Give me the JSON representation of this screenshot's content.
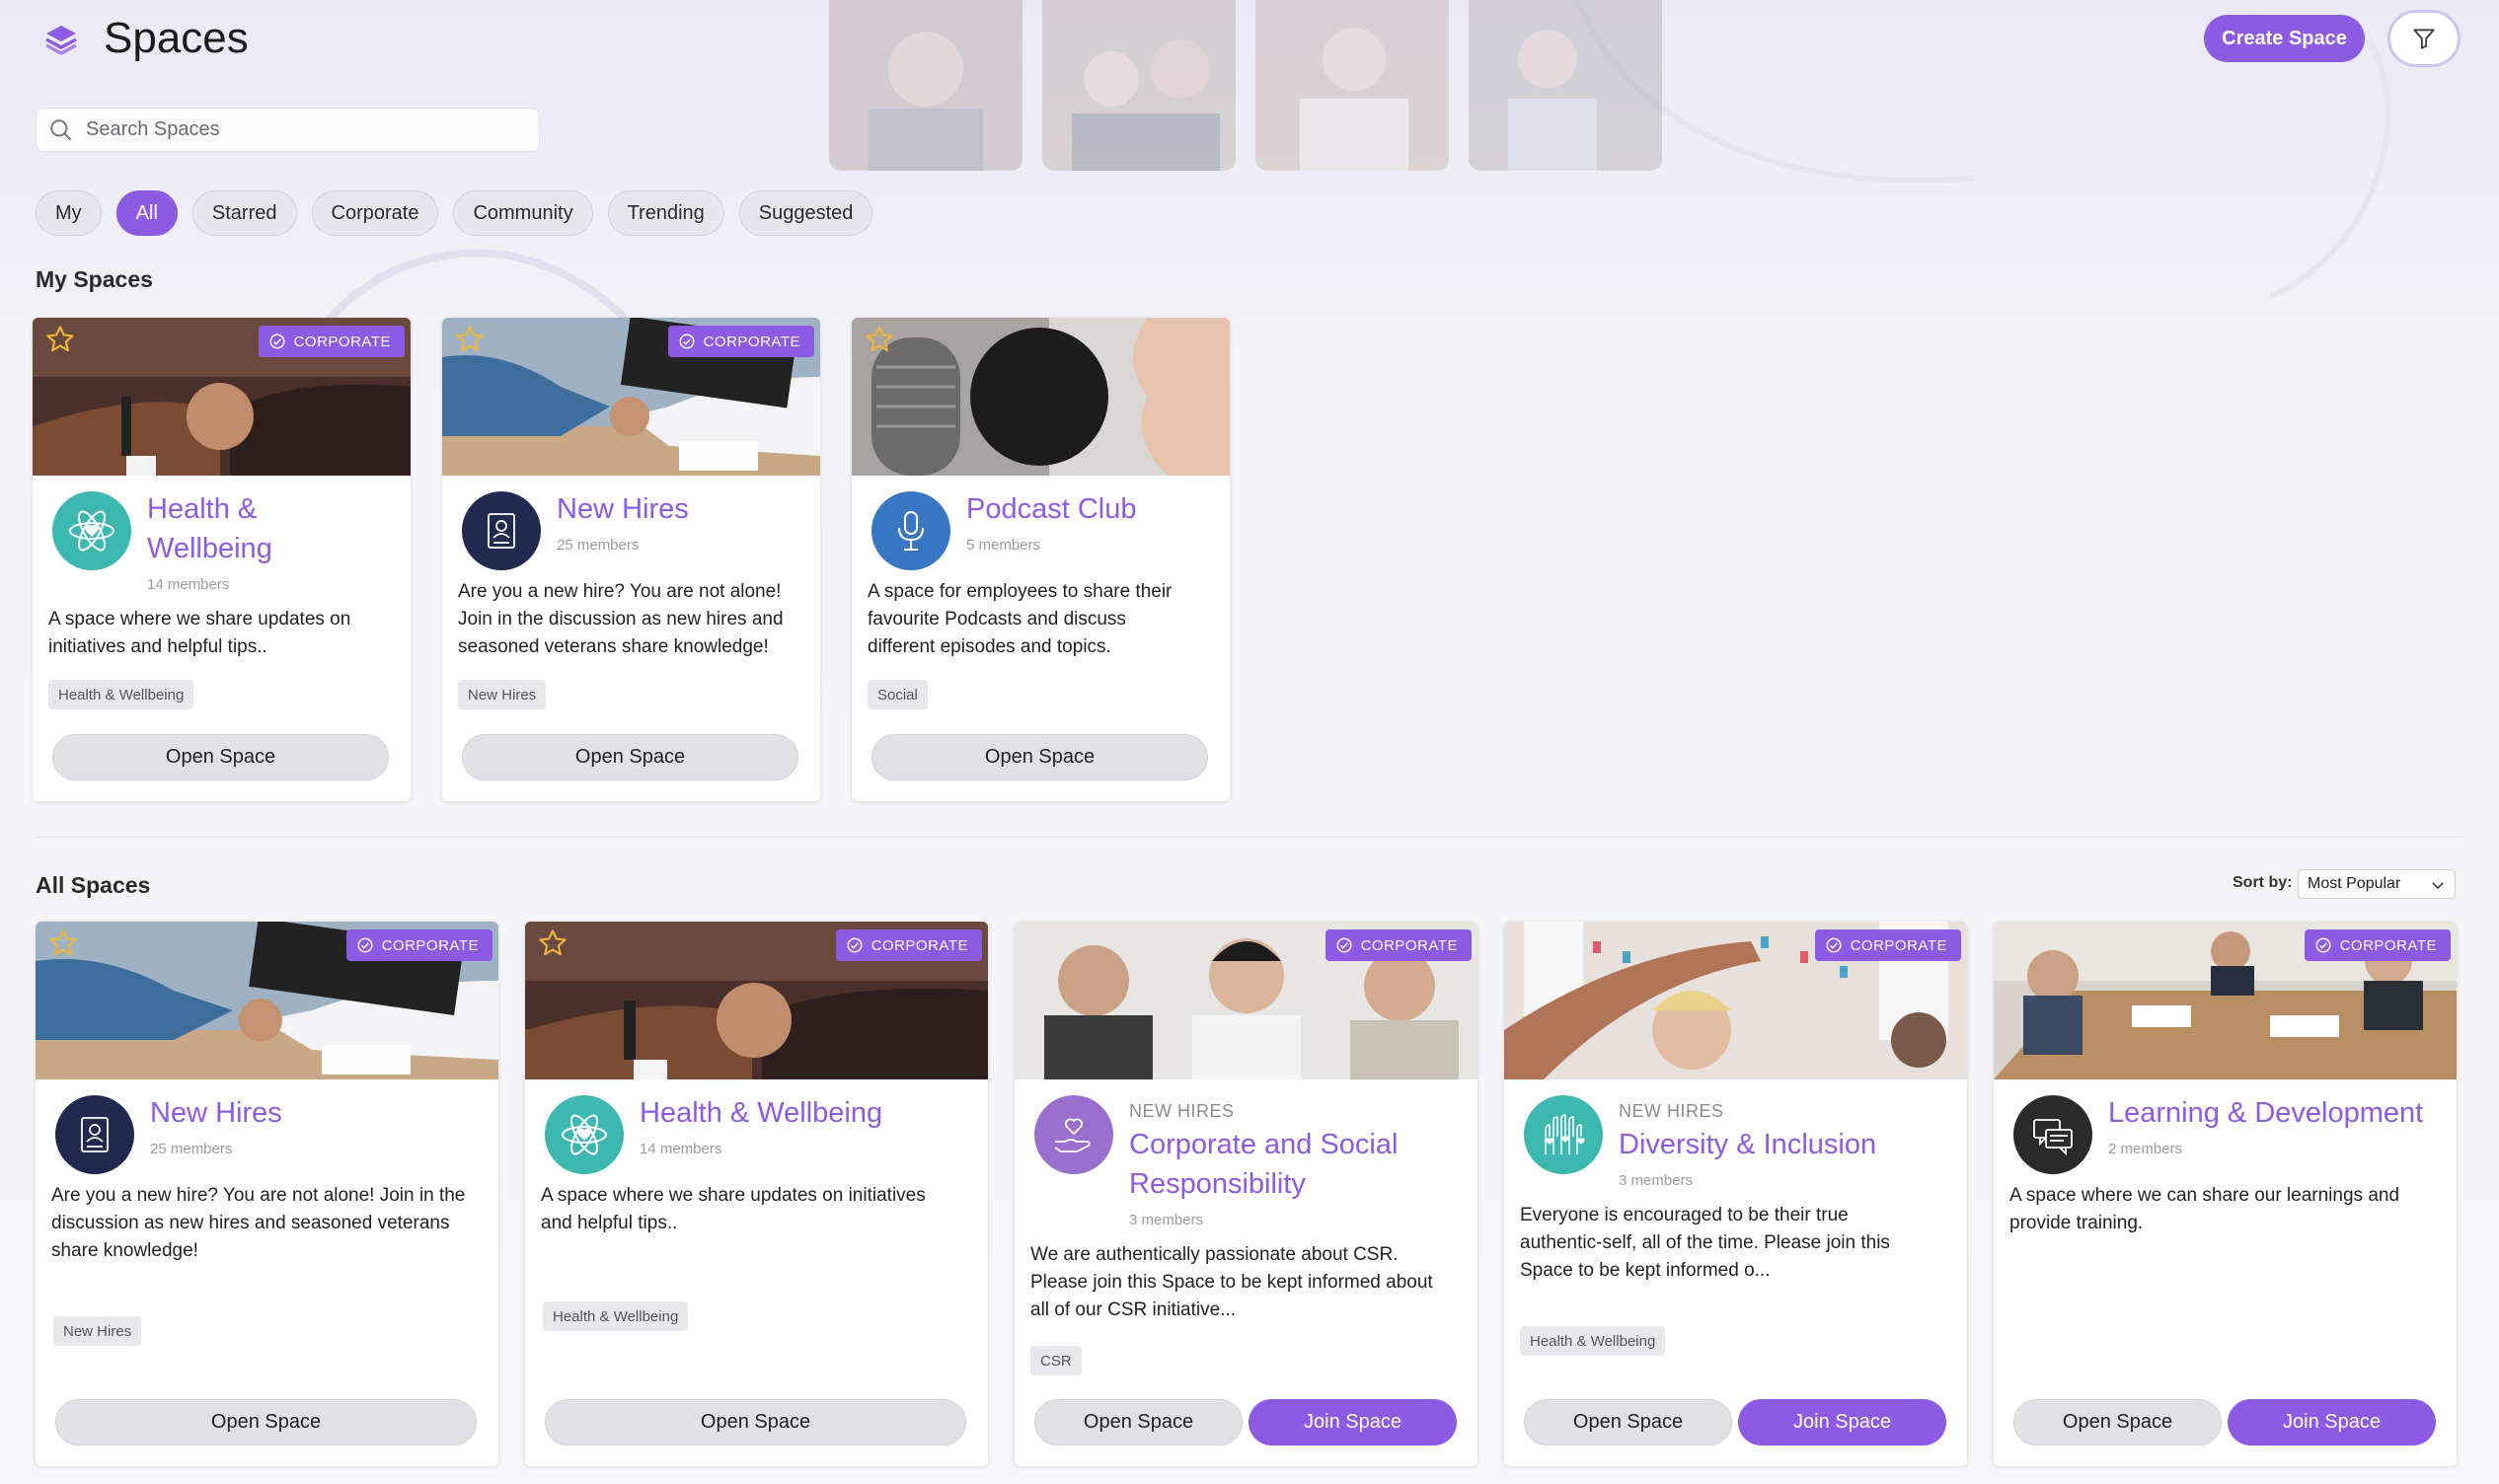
{
  "header": {
    "title": "Spaces",
    "create_label": "Create Space",
    "search_placeholder": "Search Spaces"
  },
  "filters": [
    "My",
    "All",
    "Starred",
    "Corporate",
    "Community",
    "Trending",
    "Suggested"
  ],
  "active_filter": "All",
  "my_spaces": {
    "title": "My Spaces",
    "cards": [
      {
        "title_lines": [
          "Health &",
          "Wellbeing"
        ],
        "members": "14 members",
        "desc": [
          "A space where we share updates on",
          "initiatives and helpful tips.."
        ],
        "tag": "Health & Wellbeing",
        "badge": "CORPORATE",
        "open_label": "Open Space",
        "avatar_icon": "atom-heart-icon",
        "image": "fist-bump-photo"
      },
      {
        "title_lines": [
          "New Hires"
        ],
        "members": "25 members",
        "desc": [
          "Are you a new hire? You are not alone!",
          "Join in the discussion as new hires and",
          "seasoned veterans share knowledge!"
        ],
        "tag": "New Hires",
        "badge": "CORPORATE",
        "open_label": "Open Space",
        "avatar_icon": "id-document-icon",
        "image": "handshake-photo"
      },
      {
        "title_lines": [
          "Podcast Club"
        ],
        "members": "5 members",
        "desc": [
          "A space for employees to share their",
          "favourite Podcasts and discuss",
          "different episodes and topics."
        ],
        "tag": "Social",
        "open_label": "Open Space",
        "avatar_icon": "microphone-icon",
        "image": "microphone-photo"
      }
    ]
  },
  "all_spaces": {
    "title": "All Spaces",
    "sort_label": "Sort by:",
    "sort_value": "Most Popular",
    "cards": [
      {
        "title_lines": [
          "New Hires"
        ],
        "members": "25 members",
        "desc": [
          "Are you a new hire? You are not alone! Join in the",
          "discussion as new hires and seasoned veterans",
          "share knowledge!"
        ],
        "tag": "New Hires",
        "badge": "CORPORATE",
        "open_label": "Open Space",
        "avatar_icon": "id-document-icon"
      },
      {
        "title_lines": [
          "Health & Wellbeing"
        ],
        "members": "14 members",
        "desc": [
          "A space where we share updates on initiatives",
          "and helpful tips.."
        ],
        "tag": "Health & Wellbeing",
        "badge": "CORPORATE",
        "open_label": "Open Space",
        "avatar_icon": "atom-heart-icon"
      },
      {
        "eyebrow": "NEW HIRES",
        "title_lines": [
          "Corporate and Social",
          "Responsibility"
        ],
        "members": "3 members",
        "desc": [
          "We are authentically passionate about CSR.",
          "Please join this Space to be kept informed about",
          "all of our CSR initiative..."
        ],
        "tag": "CSR",
        "badge": "CORPORATE",
        "open_label": "Open Space",
        "join_label": "Join Space",
        "avatar_icon": "hand-heart-icon"
      },
      {
        "eyebrow": "NEW HIRES",
        "title_lines": [
          "Diversity & Inclusion"
        ],
        "members": "3 members",
        "desc": [
          "Everyone is encouraged to be their true",
          "authentic-self, all of the time. Please join this",
          "Space to be kept informed o..."
        ],
        "tag": "Health & Wellbeing",
        "badge": "CORPORATE",
        "open_label": "Open Space",
        "join_label": "Join Space",
        "avatar_icon": "raised-hands-icon"
      },
      {
        "title_lines": [
          "Learning & Development"
        ],
        "members": "2 members",
        "desc": [
          "A space where we can share our learnings and",
          "provide training."
        ],
        "badge": "CORPORATE",
        "open_label": "Open Space",
        "join_label": "Join Space",
        "avatar_icon": "chat-bubbles-icon"
      }
    ]
  },
  "colors": {
    "accent": "#8d5ae3",
    "teal_avatar": "#3cb8b0",
    "navy_avatar": "#1f2a4e",
    "blue_avatar": "#3a77c2",
    "purple_avatar": "#9b6fcf",
    "dark_avatar": "#2b2b2b",
    "star": "#f0b53a"
  }
}
